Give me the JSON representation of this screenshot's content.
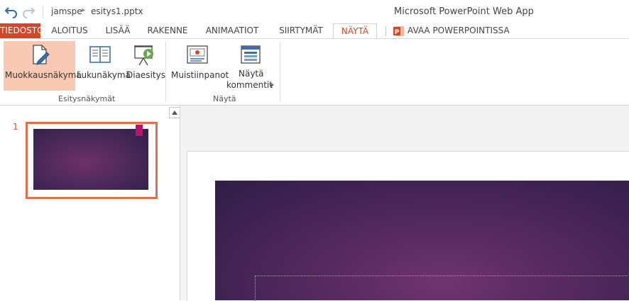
{
  "titlebar": {
    "user": "jamspe",
    "file": "esitys1.pptx",
    "app_title": "Microsoft PowerPoint Web App"
  },
  "tabs": [
    {
      "label": "TIEDOSTO"
    },
    {
      "label": "ALOITUS"
    },
    {
      "label": "LISÄÄ"
    },
    {
      "label": "RAKENNE"
    },
    {
      "label": "ANIMAATIOT"
    },
    {
      "label": "SIIRTYMÄT"
    },
    {
      "label": "NÄYTÄ"
    },
    {
      "label": "AVAA POWERPOINTISSA"
    }
  ],
  "ribbon": {
    "group_presentation_views": {
      "label": "Esitysnäkymät",
      "buttons": [
        {
          "label": "Muokkausnäkymä"
        },
        {
          "label": "Lukunäkymä"
        },
        {
          "label": "Diaesitys"
        }
      ]
    },
    "group_show": {
      "label": "Näytä",
      "buttons": [
        {
          "label": "Muistiinpanot"
        },
        {
          "label_line1": "Näytä",
          "label_line2": "kommentit"
        }
      ]
    }
  },
  "slides_panel": {
    "slides": [
      {
        "number": "1"
      }
    ]
  },
  "colors": {
    "accent": "#d24726",
    "selected_button": "#f9c9b3",
    "thumb_border": "#e0714f",
    "slide_dark": "#2e1d47",
    "slide_mid": "#6f3470"
  }
}
